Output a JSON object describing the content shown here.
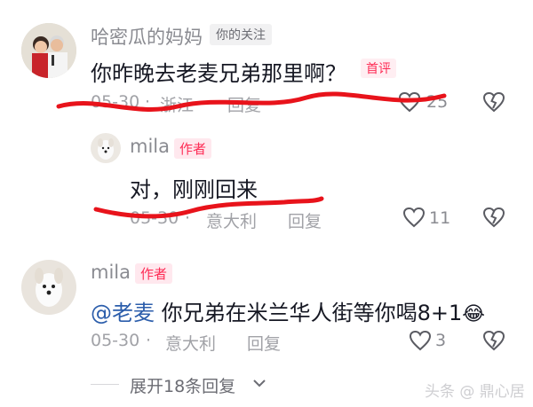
{
  "comment1": {
    "username": "哈密瓜的妈妈",
    "follow_tag": "你的关注",
    "text": "你昨晚去老麦兄弟那里啊？",
    "first_tag": "首评",
    "date": "05-30",
    "location": "浙江",
    "reply_label": "回复",
    "like_count": "25",
    "avatar_icon": "family-photo-avatar"
  },
  "reply1": {
    "username": "mila",
    "author_tag": "作者",
    "text": "对，刚刚回来",
    "date": "05-30",
    "location": "意大利",
    "reply_label": "回复",
    "like_count": "11",
    "avatar_icon": "dog-avatar"
  },
  "comment2": {
    "username": "mila",
    "author_tag": "作者",
    "mention": "@老麦",
    "text": "你兄弟在米兰华人街等你喝8+1",
    "emoji": "😂",
    "date": "05-30",
    "location": "意大利",
    "reply_label": "回复",
    "like_count": "3",
    "avatar_icon": "dog-avatar"
  },
  "expand": {
    "label": "展开18条回复"
  },
  "watermark": "头条 @ 鼎心居",
  "colors": {
    "accent": "#fe2c55",
    "mention": "#2b5dab",
    "scribble": "#e8131b"
  }
}
